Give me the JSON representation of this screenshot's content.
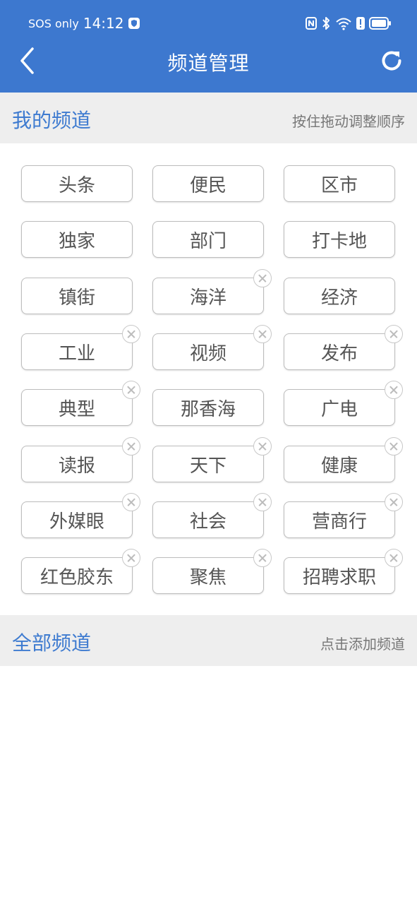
{
  "status_bar": {
    "sos": "SOS only",
    "time": "14:12"
  },
  "header": {
    "title": "频道管理"
  },
  "my_channels": {
    "title": "我的频道",
    "hint": "按住拖动调整顺序",
    "items": [
      {
        "label": "头条",
        "removable": false
      },
      {
        "label": "便民",
        "removable": false
      },
      {
        "label": "区市",
        "removable": false
      },
      {
        "label": "独家",
        "removable": false
      },
      {
        "label": "部门",
        "removable": false
      },
      {
        "label": "打卡地",
        "removable": false
      },
      {
        "label": "镇街",
        "removable": false
      },
      {
        "label": "海洋",
        "removable": true
      },
      {
        "label": "经济",
        "removable": false
      },
      {
        "label": "工业",
        "removable": true
      },
      {
        "label": "视频",
        "removable": true
      },
      {
        "label": "发布",
        "removable": true
      },
      {
        "label": "典型",
        "removable": true
      },
      {
        "label": "那香海",
        "removable": false
      },
      {
        "label": "广电",
        "removable": true
      },
      {
        "label": "读报",
        "removable": true
      },
      {
        "label": "天下",
        "removable": true
      },
      {
        "label": "健康",
        "removable": true
      },
      {
        "label": "外媒眼",
        "removable": true
      },
      {
        "label": "社会",
        "removable": true
      },
      {
        "label": "营商行",
        "removable": true
      },
      {
        "label": "红色胶东",
        "removable": true
      },
      {
        "label": "聚焦",
        "removable": true
      },
      {
        "label": "招聘求职",
        "removable": true
      }
    ]
  },
  "all_channels": {
    "title": "全部频道",
    "hint": "点击添加频道"
  },
  "colors": {
    "header": "#3d78cf",
    "section_title": "#3e7bd0",
    "section_bg": "#eeeeee"
  }
}
